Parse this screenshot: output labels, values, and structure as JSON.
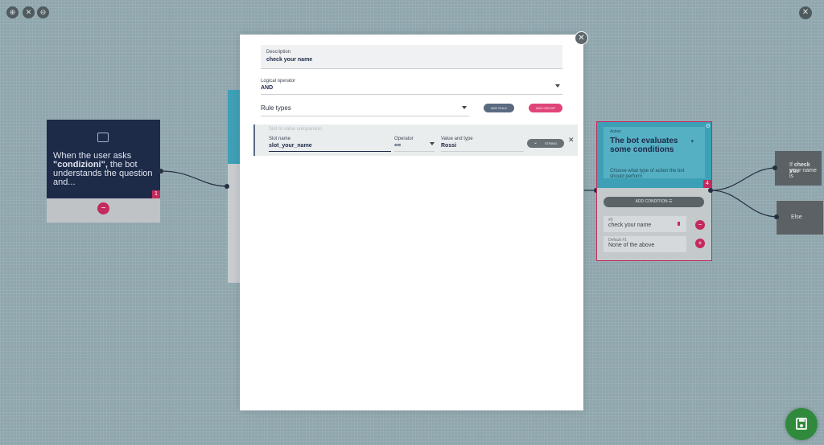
{
  "toolbar": {
    "zoom_in": "⊕",
    "reset": "✕",
    "zoom_out": "⊖",
    "close": "✕"
  },
  "left_card": {
    "text_prefix": "When the user asks ",
    "text_bold": "\"condizioni\",",
    "text_suffix": " the bot understands the question and...",
    "badge": "1",
    "minus": "−"
  },
  "condition_card": {
    "label": "Action",
    "title": "The bot evaluates some conditions",
    "description": "Choose what type of action the bot should perform",
    "badge": "4",
    "add_condition": "ADD CONDITION",
    "conditions": [
      {
        "index": "#0",
        "name": "check your name"
      },
      {
        "index": "Default #1",
        "name": "None of the above"
      }
    ]
  },
  "outcomes": [
    {
      "prefix": "If ",
      "bold": "check yo",
      "suffix": "ur name is",
      "second": "true"
    },
    {
      "prefix": "Else",
      "bold": "",
      "suffix": "",
      "second": ""
    }
  ],
  "modal": {
    "close": "✕",
    "description": {
      "label": "Description",
      "value": "check your name"
    },
    "logical_operator": {
      "label": "Logical operator",
      "value": "AND"
    },
    "rule_types": {
      "placeholder": "Rule types"
    },
    "add_rule": "ADD RULE",
    "add_group": "ADD GROUP",
    "rule": {
      "title": "Slot to value comparison",
      "slot_label": "Slot name",
      "slot_value": "slot_your_name",
      "operator_label": "Operator",
      "operator_value": "==",
      "value_label": "Value and type",
      "value_value": "Rossi",
      "type": "STRING",
      "remove": "✕"
    }
  },
  "colors": {
    "accent": "#c32a5d",
    "navy": "#1d2a48",
    "cyan": "#3ea0b6",
    "save": "#2f8a3c"
  }
}
